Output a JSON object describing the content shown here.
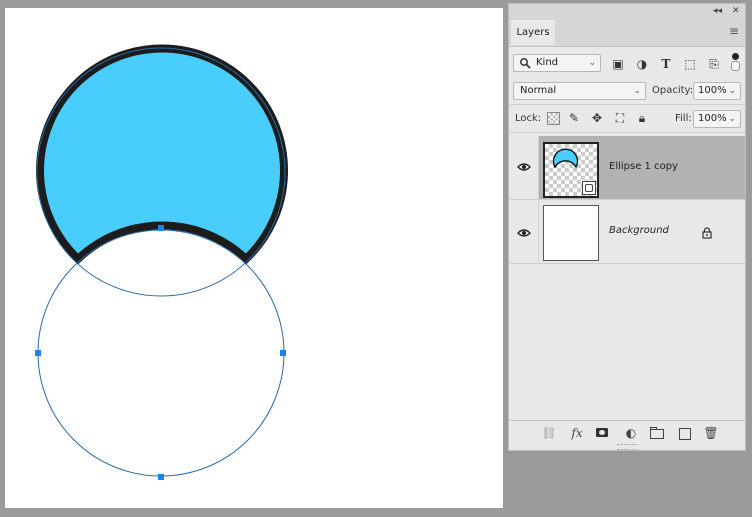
{
  "panel": {
    "collapse_icon": "collapse-icon",
    "close_icon": "close-icon",
    "tab": "Layers",
    "menu_icon": "panel-menu-icon"
  },
  "filter": {
    "kind_label": "Kind",
    "icons": [
      "image-filter-icon",
      "adjustment-filter-icon",
      "type-filter-icon",
      "shape-filter-icon",
      "smart-object-filter-icon"
    ]
  },
  "blend": {
    "mode": "Normal",
    "opacity_label": "Opacity:",
    "opacity_value": "100%"
  },
  "lock": {
    "label": "Lock:",
    "icons": [
      "lock-transparent-pixels-icon",
      "lock-image-pixels-icon",
      "lock-position-icon",
      "lock-artboard-icon",
      "lock-all-icon"
    ],
    "fill_label": "Fill:",
    "fill_value": "100%"
  },
  "layers": [
    {
      "name": "Ellipse 1 copy",
      "visible": true,
      "selected": true,
      "type": "shape"
    },
    {
      "name": "Background",
      "visible": true,
      "selected": false,
      "locked": true
    }
  ],
  "bottom_icons": [
    "link-layers-icon",
    "fx-icon",
    "add-mask-icon",
    "adjustment-layer-icon",
    "new-group-icon",
    "new-layer-icon",
    "delete-icon"
  ],
  "bottom_fx": "fx",
  "colors": {
    "shape_fill": "#48cdfd",
    "shape_stroke": "#1c1c1c",
    "path_outline": "#2a6aa8",
    "anchor": "#1a84ee",
    "selected_row": "#b2b2b2"
  }
}
